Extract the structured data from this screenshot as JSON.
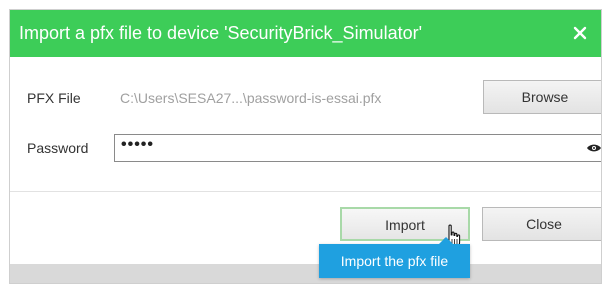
{
  "dialog": {
    "title": "Import a pfx file to device 'SecurityBrick_Simulator'",
    "accent_color": "#3dcd58"
  },
  "form": {
    "pfx_label": "PFX File",
    "pfx_path": "C:\\Users\\SESA27...\\password-is-essai.pfx",
    "password_label": "Password",
    "password_value": "•••••"
  },
  "buttons": {
    "browse_label": "Browse",
    "import_label": "Import",
    "close_label": "Close"
  },
  "tooltip": {
    "text": "Import the pfx file",
    "color": "#1fa0e0"
  },
  "icons": {
    "close": "close-icon",
    "reveal_password": "eye-icon",
    "pointer": "hand-cursor-icon"
  }
}
